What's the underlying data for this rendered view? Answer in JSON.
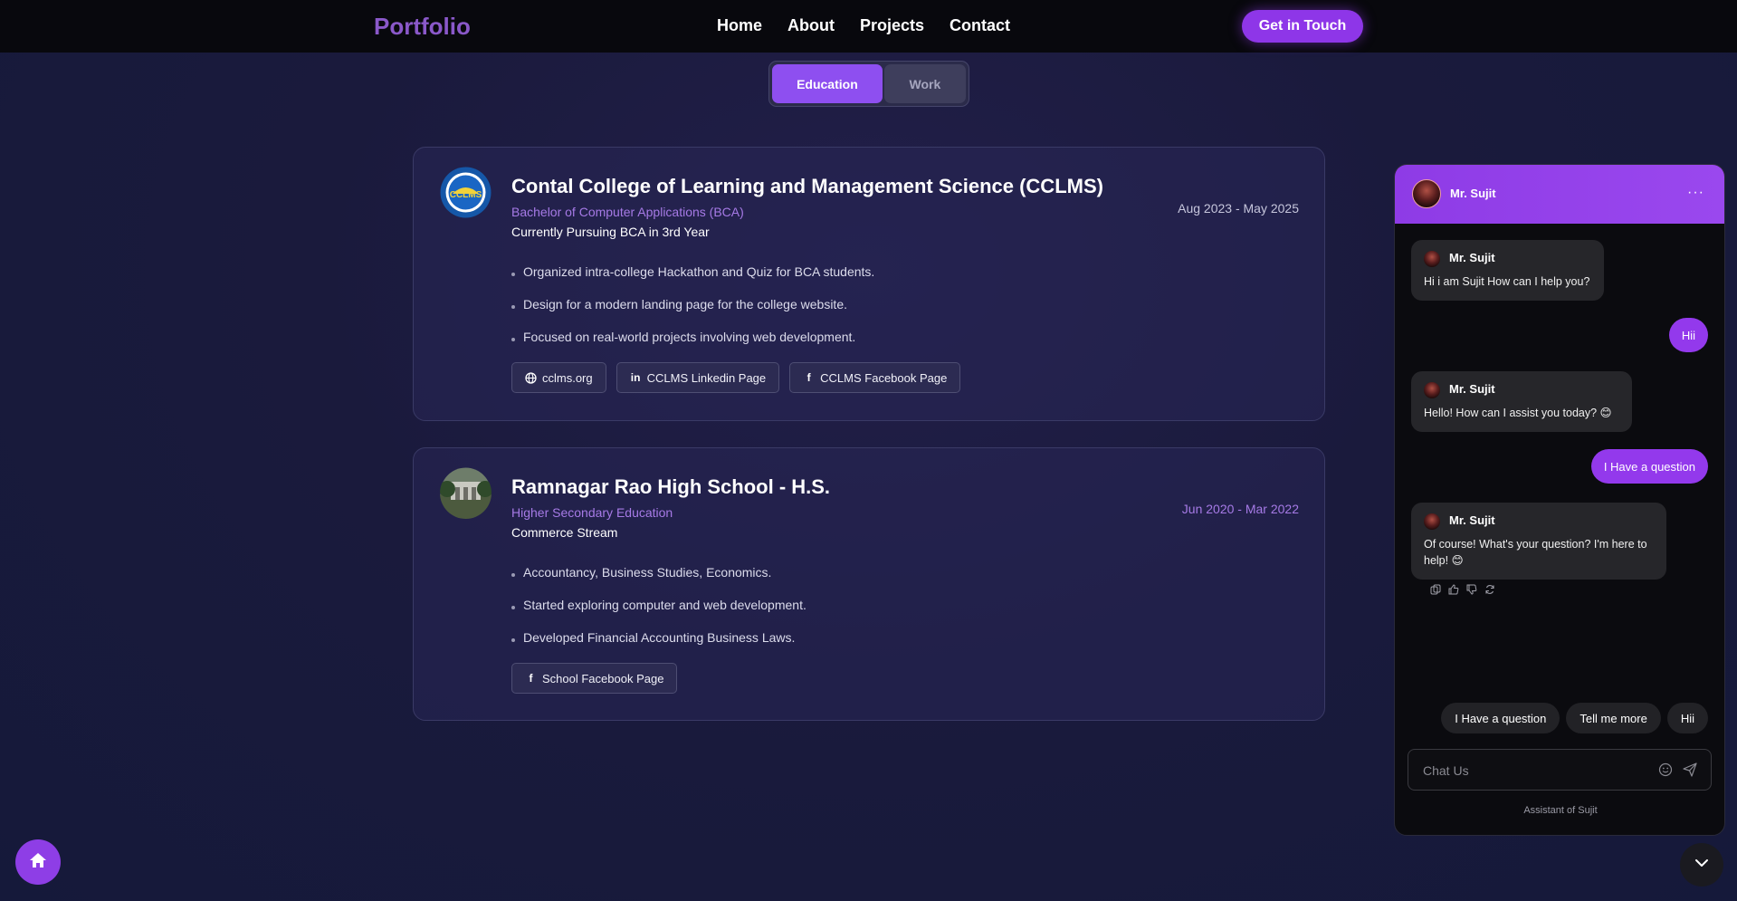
{
  "navbar": {
    "logo": "Portfolio",
    "links": [
      "Home",
      "About",
      "Projects",
      "Contact"
    ],
    "cta": "Get in Touch"
  },
  "tabs": {
    "education": "Education",
    "work": "Work",
    "active": "Education"
  },
  "education": [
    {
      "title": "Contal College of Learning and Management Science (CCLMS)",
      "degree": "Bachelor of Computer Applications (BCA)",
      "status": "Currently Pursuing BCA in 3rd Year",
      "date": "Aug 2023 - May 2025",
      "logo_text": "CCLMS",
      "bullets": [
        "Organized intra-college Hackathon and Quiz for BCA students.",
        "Design for a modern landing page for the college website.",
        "Focused on real-world projects involving web development."
      ],
      "links": [
        {
          "label": "cclms.org",
          "icon": "globe-icon"
        },
        {
          "label": "CCLMS Linkedin Page",
          "icon": "linkedin-icon"
        },
        {
          "label": "CCLMS Facebook Page",
          "icon": "facebook-icon"
        }
      ]
    },
    {
      "title": "Ramnagar Rao High School - H.S.",
      "degree": "Higher Secondary Education",
      "status": "Commerce Stream",
      "date": "Jun 2020 - Mar 2022",
      "bullets": [
        "Accountancy, Business Studies, Economics.",
        "Started exploring computer and web development.",
        "Developed Financial Accounting Business Laws."
      ],
      "links": [
        {
          "label": "School Facebook Page",
          "icon": "facebook-icon"
        }
      ]
    }
  ],
  "chat": {
    "name": "Mr. Sujit",
    "menu": "···",
    "messages": [
      {
        "from": "bot",
        "name": "Mr. Sujit",
        "text": "Hi i am Sujit How can I help you?"
      },
      {
        "from": "user",
        "text": "Hii"
      },
      {
        "from": "bot",
        "name": "Mr. Sujit",
        "text": "Hello! How can I assist you today? 😊"
      },
      {
        "from": "user",
        "text": "I Have a question"
      },
      {
        "from": "bot",
        "name": "Mr. Sujit",
        "text": "Of course! What's your question? I'm here to help! 😊"
      }
    ],
    "quick_replies": [
      "I Have a question",
      "Tell me more",
      "Hii"
    ],
    "input_placeholder": "Chat Us",
    "footer": "Assistant of Sujit"
  },
  "colors": {
    "accent": "#8e36e8",
    "degree_text": "#a67ae6",
    "background": "#1a1a3c"
  }
}
